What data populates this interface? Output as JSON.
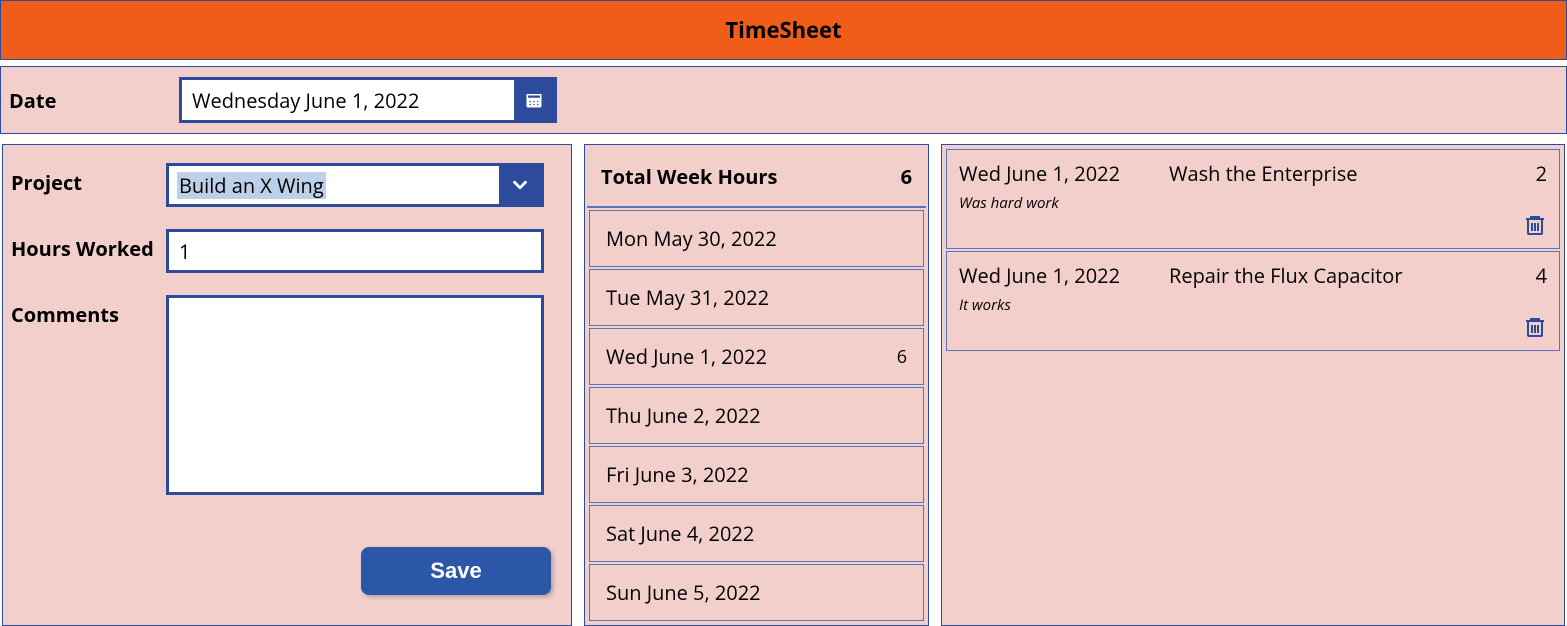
{
  "header": {
    "title": "TimeSheet"
  },
  "date_bar": {
    "label": "Date",
    "value": "Wednesday June 1, 2022"
  },
  "form": {
    "project_label": "Project",
    "project_value": "Build an X Wing",
    "hours_label": "Hours Worked",
    "hours_value": "1",
    "comments_label": "Comments",
    "comments_value": "",
    "save_label": "Save"
  },
  "week": {
    "total_label": "Total Week Hours",
    "total_value": "6",
    "days": [
      {
        "label": "Mon May 30, 2022",
        "hours": ""
      },
      {
        "label": "Tue May 31, 2022",
        "hours": ""
      },
      {
        "label": "Wed June 1, 2022",
        "hours": "6"
      },
      {
        "label": "Thu June 2, 2022",
        "hours": ""
      },
      {
        "label": "Fri June 3, 2022",
        "hours": ""
      },
      {
        "label": "Sat June 4, 2022",
        "hours": ""
      },
      {
        "label": "Sun June 5, 2022",
        "hours": ""
      }
    ]
  },
  "entries": [
    {
      "date": "Wed June 1, 2022",
      "project": "Wash the Enterprise",
      "hours": "2",
      "comment": "Was hard work"
    },
    {
      "date": "Wed June 1, 2022",
      "project": "Repair the Flux Capacitor",
      "hours": "4",
      "comment": "It works"
    }
  ]
}
